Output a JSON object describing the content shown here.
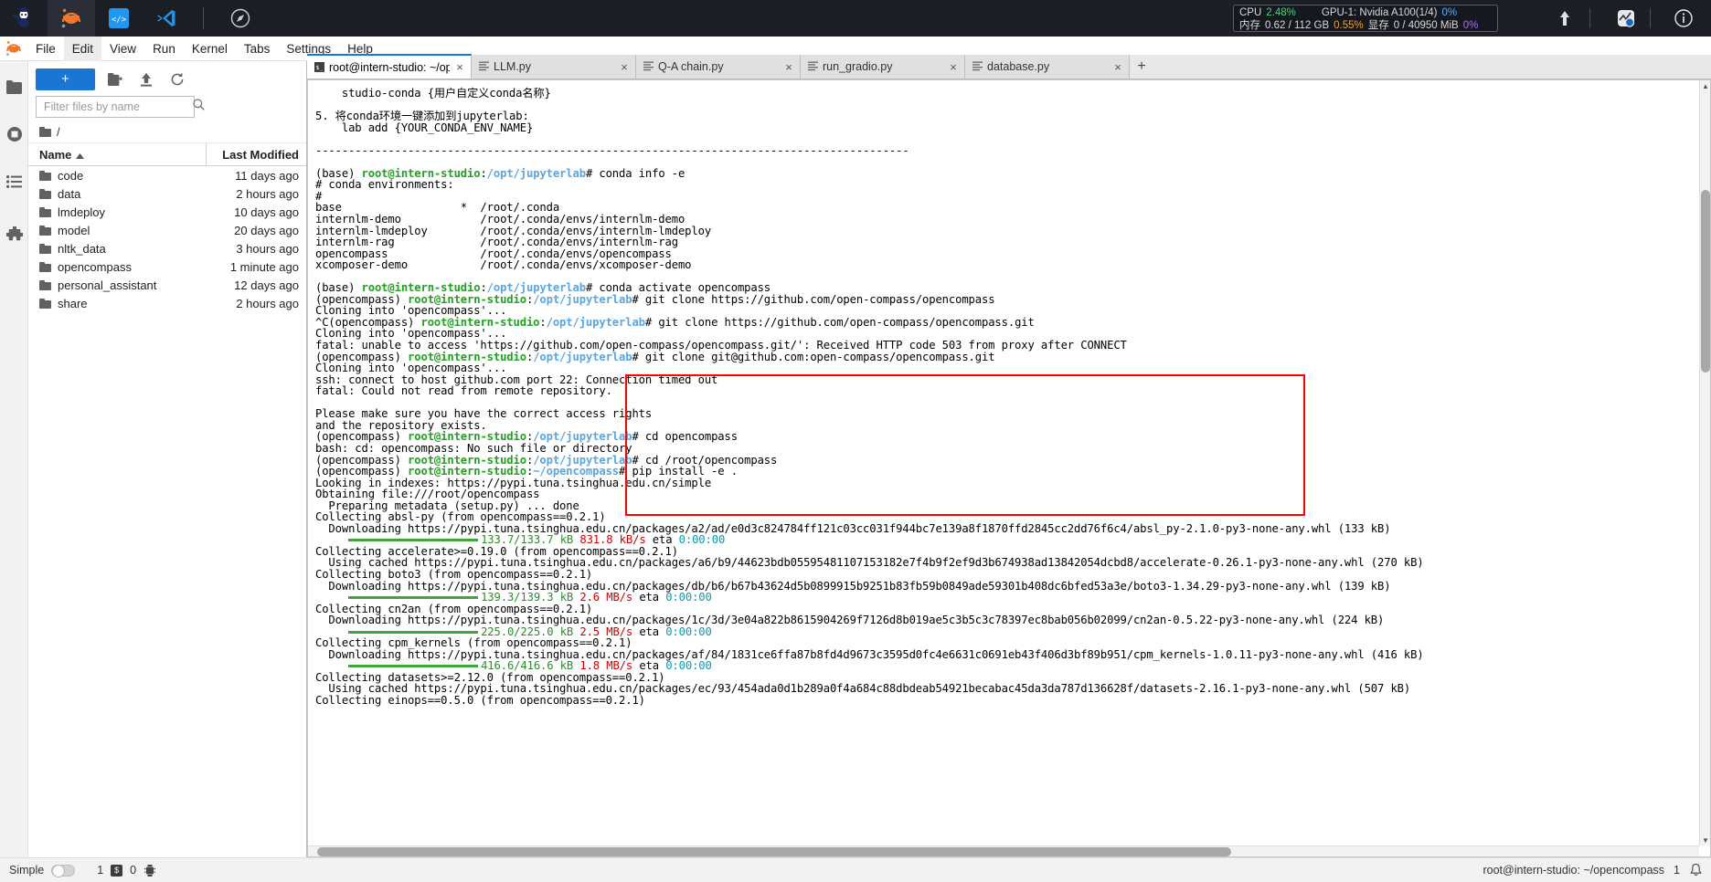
{
  "topbar": {
    "apps": [
      {
        "name": "internstudio-logo",
        "label": ""
      },
      {
        "name": "jupyter-logo",
        "label": ""
      },
      {
        "name": "code-server-icon",
        "label": ""
      },
      {
        "name": "vscode-icon",
        "label": ""
      },
      {
        "name": "compass-icon",
        "label": ""
      }
    ],
    "sysmon": {
      "cpu_label": "CPU",
      "cpu_value": "2.48%",
      "gpu_label": "GPU-1: Nvidia A100(1/4)",
      "gpu_value": "0%",
      "mem_label": "内存",
      "mem_value": "0.62 / 112 GB",
      "mem_pct": "0.55%",
      "vram_label": "显存",
      "vram_value": "0 / 40950 MiB",
      "vram_pct": "0%"
    },
    "right_icons": [
      "upload-icon",
      "activity-monitor-icon",
      "info-icon"
    ]
  },
  "menubar": {
    "logo": "jupyter-logo",
    "items": [
      "File",
      "Edit",
      "View",
      "Run",
      "Kernel",
      "Tabs",
      "Settings",
      "Help"
    ],
    "highlighted": "Edit"
  },
  "activitybar": {
    "items": [
      {
        "name": "file-browser-icon"
      },
      {
        "name": "running-terminals-icon"
      },
      {
        "name": "table-of-contents-icon"
      },
      {
        "name": "extensions-icon"
      }
    ],
    "right_items": [
      {
        "name": "property-inspector-icon"
      },
      {
        "name": "debugger-icon"
      }
    ]
  },
  "filebrowser": {
    "new_launcher_label": "+",
    "toolbar_icons": [
      "new-folder-icon",
      "upload-files-icon",
      "refresh-icon"
    ],
    "filter_placeholder": "Filter files by name",
    "filter_value": "",
    "breadcrumb": "/",
    "columns": {
      "name": "Name",
      "modified": "Last Modified"
    },
    "sort_direction": "ascending",
    "rows": [
      {
        "name": "code",
        "modified": "11 days ago"
      },
      {
        "name": "data",
        "modified": "2 hours ago"
      },
      {
        "name": "lmdeploy",
        "modified": "10 days ago"
      },
      {
        "name": "model",
        "modified": "20 days ago"
      },
      {
        "name": "nltk_data",
        "modified": "3 hours ago"
      },
      {
        "name": "opencompass",
        "modified": "1 minute ago"
      },
      {
        "name": "personal_assistant",
        "modified": "12 days ago"
      },
      {
        "name": "share",
        "modified": "2 hours ago"
      }
    ]
  },
  "tabs": {
    "items": [
      {
        "label": "root@intern-studio: ~/ope",
        "icon": "terminal-icon",
        "active": true
      },
      {
        "label": "LLM.py",
        "icon": "file-text-icon",
        "active": false
      },
      {
        "label": "Q-A chain.py",
        "icon": "file-text-icon",
        "active": false
      },
      {
        "label": "run_gradio.py",
        "icon": "file-text-icon",
        "active": false
      },
      {
        "label": "database.py",
        "icon": "file-text-icon",
        "active": false
      }
    ],
    "add_label": "+"
  },
  "terminal": {
    "lines": [
      [
        {
          "t": "    studio-conda {用户自定义conda名称}",
          "c": "blk"
        }
      ],
      [
        {
          "t": "",
          "c": "blk"
        }
      ],
      [
        {
          "t": "5. 将conda环境一键添加到jupyterlab:",
          "c": "blk"
        }
      ],
      [
        {
          "t": "    lab add {YOUR_CONDA_ENV_NAME}",
          "c": "blk"
        }
      ],
      [
        {
          "t": "",
          "c": "blk"
        }
      ],
      [
        {
          "t": "------------------------------------------------------------------------------------------",
          "c": "blk"
        }
      ],
      [
        {
          "t": "",
          "c": "blk"
        }
      ],
      [
        {
          "t": "(base) ",
          "c": "blk"
        },
        {
          "t": "root@intern-studio",
          "c": "green"
        },
        {
          "t": ":",
          "c": "blk"
        },
        {
          "t": "/opt/jupyterlab",
          "c": "blue"
        },
        {
          "t": "# conda info -e",
          "c": "blk"
        }
      ],
      [
        {
          "t": "# conda environments:",
          "c": "blk"
        }
      ],
      [
        {
          "t": "#",
          "c": "blk"
        }
      ],
      [
        {
          "t": "base                  *  /root/.conda",
          "c": "blk"
        }
      ],
      [
        {
          "t": "internlm-demo            /root/.conda/envs/internlm-demo",
          "c": "blk"
        }
      ],
      [
        {
          "t": "internlm-lmdeploy        /root/.conda/envs/internlm-lmdeploy",
          "c": "blk"
        }
      ],
      [
        {
          "t": "internlm-rag             /root/.conda/envs/internlm-rag",
          "c": "blk"
        }
      ],
      [
        {
          "t": "opencompass              /root/.conda/envs/opencompass",
          "c": "blk"
        }
      ],
      [
        {
          "t": "xcomposer-demo           /root/.conda/envs/xcomposer-demo",
          "c": "blk"
        }
      ],
      [
        {
          "t": "",
          "c": "blk"
        }
      ],
      [
        {
          "t": "(base) ",
          "c": "blk"
        },
        {
          "t": "root@intern-studio",
          "c": "green"
        },
        {
          "t": ":",
          "c": "blk"
        },
        {
          "t": "/opt/jupyterlab",
          "c": "blue"
        },
        {
          "t": "# conda activate opencompass",
          "c": "blk"
        }
      ],
      [
        {
          "t": "(opencompass) ",
          "c": "blk"
        },
        {
          "t": "root@intern-studio",
          "c": "green"
        },
        {
          "t": ":",
          "c": "blk"
        },
        {
          "t": "/opt/jupyterlab",
          "c": "blue"
        },
        {
          "t": "# git clone https://github.com/open-compass/opencompass",
          "c": "blk"
        }
      ],
      [
        {
          "t": "Cloning into 'opencompass'...",
          "c": "blk"
        }
      ],
      [
        {
          "t": "^C(opencompass) ",
          "c": "blk"
        },
        {
          "t": "root@intern-studio",
          "c": "green"
        },
        {
          "t": ":",
          "c": "blk"
        },
        {
          "t": "/opt/jupyterlab",
          "c": "blue"
        },
        {
          "t": "# git clone https://github.com/open-compass/opencompass.git",
          "c": "blk"
        }
      ],
      [
        {
          "t": "Cloning into 'opencompass'...",
          "c": "blk"
        }
      ],
      [
        {
          "t": "fatal: unable to access 'https://github.com/open-compass/opencompass.git/': Received HTTP code 503 from proxy after CONNECT",
          "c": "blk"
        }
      ],
      [
        {
          "t": "(opencompass) ",
          "c": "blk"
        },
        {
          "t": "root@intern-studio",
          "c": "green"
        },
        {
          "t": ":",
          "c": "blk"
        },
        {
          "t": "/opt/jupyterlab",
          "c": "blue"
        },
        {
          "t": "# git clone git@github.com:open-compass/opencompass.git",
          "c": "blk"
        }
      ],
      [
        {
          "t": "Cloning into 'opencompass'...",
          "c": "blk"
        }
      ],
      [
        {
          "t": "ssh: connect to host github.com port 22: Connection timed out",
          "c": "blk"
        }
      ],
      [
        {
          "t": "fatal: Could not read from remote repository.",
          "c": "blk"
        }
      ],
      [
        {
          "t": "",
          "c": "blk"
        }
      ],
      [
        {
          "t": "Please make sure you have the correct access rights",
          "c": "blk"
        }
      ],
      [
        {
          "t": "and the repository exists.",
          "c": "blk"
        }
      ],
      [
        {
          "t": "(opencompass) ",
          "c": "blk"
        },
        {
          "t": "root@intern-studio",
          "c": "green"
        },
        {
          "t": ":",
          "c": "blk"
        },
        {
          "t": "/opt/jupyterlab",
          "c": "blue"
        },
        {
          "t": "# cd opencompass",
          "c": "blk"
        }
      ],
      [
        {
          "t": "bash: cd: opencompass: No such file or directory",
          "c": "blk"
        }
      ],
      [
        {
          "t": "(opencompass) ",
          "c": "blk"
        },
        {
          "t": "root@intern-studio",
          "c": "green"
        },
        {
          "t": ":",
          "c": "blk"
        },
        {
          "t": "/opt/jupyterlab",
          "c": "blue"
        },
        {
          "t": "# cd /root/opencompass",
          "c": "blk"
        }
      ],
      [
        {
          "t": "(opencompass) ",
          "c": "blk"
        },
        {
          "t": "root@intern-studio",
          "c": "green"
        },
        {
          "t": ":",
          "c": "blk"
        },
        {
          "t": "~/opencompass",
          "c": "blue"
        },
        {
          "t": "# pip install -e .",
          "c": "blk"
        }
      ],
      [
        {
          "t": "Looking in indexes: https://pypi.tuna.tsinghua.edu.cn/simple",
          "c": "blk"
        }
      ],
      [
        {
          "t": "Obtaining file:///root/opencompass",
          "c": "blk"
        }
      ],
      [
        {
          "t": "  Preparing metadata (setup.py) ... done",
          "c": "blk"
        }
      ],
      [
        {
          "t": "Collecting absl-py (from opencompass==0.2.1)",
          "c": "blk"
        }
      ],
      [
        {
          "t": "  Downloading https://pypi.tuna.tsinghua.edu.cn/packages/a2/ad/e0d3c824784ff121c03cc031f944bc7e139a8f1870ffd2845cc2dd76f6c4/absl_py-2.1.0-py3-none-any.whl (133 kB)",
          "c": "blk"
        }
      ],
      [
        {
          "t": "BAR",
          "c": "bar"
        },
        {
          "t": "133.7/133.7 kB ",
          "c": "grn2"
        },
        {
          "t": "831.8 kB/s ",
          "c": "red"
        },
        {
          "t": "eta ",
          "c": "blk"
        },
        {
          "t": "0:00:00",
          "c": "cyan"
        }
      ],
      [
        {
          "t": "Collecting accelerate>=0.19.0 (from opencompass==0.2.1)",
          "c": "blk"
        }
      ],
      [
        {
          "t": "  Using cached https://pypi.tuna.tsinghua.edu.cn/packages/a6/b9/44623bdb05595481107153182e7f4b9f2ef9d3b674938ad13842054dcbd8/accelerate-0.26.1-py3-none-any.whl (270 kB)",
          "c": "blk"
        }
      ],
      [
        {
          "t": "Collecting boto3 (from opencompass==0.2.1)",
          "c": "blk"
        }
      ],
      [
        {
          "t": "  Downloading https://pypi.tuna.tsinghua.edu.cn/packages/db/b6/b67b43624d5b0899915b9251b83fb59b0849ade59301b408dc6bfed53a3e/boto3-1.34.29-py3-none-any.whl (139 kB)",
          "c": "blk"
        }
      ],
      [
        {
          "t": "BAR",
          "c": "bar"
        },
        {
          "t": "139.3/139.3 kB ",
          "c": "grn2"
        },
        {
          "t": "2.6 MB/s ",
          "c": "red"
        },
        {
          "t": "eta ",
          "c": "blk"
        },
        {
          "t": "0:00:00",
          "c": "cyan"
        }
      ],
      [
        {
          "t": "Collecting cn2an (from opencompass==0.2.1)",
          "c": "blk"
        }
      ],
      [
        {
          "t": "  Downloading https://pypi.tuna.tsinghua.edu.cn/packages/1c/3d/3e04a822b8615904269f7126d8b019ae5c3b5c3c78397ec8bab056b02099/cn2an-0.5.22-py3-none-any.whl (224 kB)",
          "c": "blk"
        }
      ],
      [
        {
          "t": "BAR",
          "c": "bar"
        },
        {
          "t": "225.0/225.0 kB ",
          "c": "grn2"
        },
        {
          "t": "2.5 MB/s ",
          "c": "red"
        },
        {
          "t": "eta ",
          "c": "blk"
        },
        {
          "t": "0:00:00",
          "c": "cyan"
        }
      ],
      [
        {
          "t": "Collecting cpm_kernels (from opencompass==0.2.1)",
          "c": "blk"
        }
      ],
      [
        {
          "t": "  Downloading https://pypi.tuna.tsinghua.edu.cn/packages/af/84/1831ce6ffa87b8fd4d9673c3595d0fc4e6631c0691eb43f406d3bf89b951/cpm_kernels-1.0.11-py3-none-any.whl (416 kB)",
          "c": "blk"
        }
      ],
      [
        {
          "t": "BAR",
          "c": "bar"
        },
        {
          "t": "416.6/416.6 kB ",
          "c": "grn2"
        },
        {
          "t": "1.8 MB/s ",
          "c": "red"
        },
        {
          "t": "eta ",
          "c": "blk"
        },
        {
          "t": "0:00:00",
          "c": "cyan"
        }
      ],
      [
        {
          "t": "Collecting datasets>=2.12.0 (from opencompass==0.2.1)",
          "c": "blk"
        }
      ],
      [
        {
          "t": "  Using cached https://pypi.tuna.tsinghua.edu.cn/packages/ec/93/454ada0d1b289a0f4a684c88dbdeab54921becabac45da3da787d136628f/datasets-2.16.1-py3-none-any.whl (507 kB)",
          "c": "blk"
        }
      ],
      [
        {
          "t": "Collecting einops==0.5.0 (from opencompass==0.2.1)",
          "c": "blk"
        }
      ]
    ]
  },
  "statusbar": {
    "mode_label": "Simple",
    "terminals_count": "1",
    "kernels_count": "0",
    "kernel_icon": "kernel-icon",
    "terminal_icon": "terminal-chip-icon",
    "path": "root@intern-studio: ~/opencompass",
    "notification_count": "1",
    "notification_icon": "bell-icon"
  }
}
